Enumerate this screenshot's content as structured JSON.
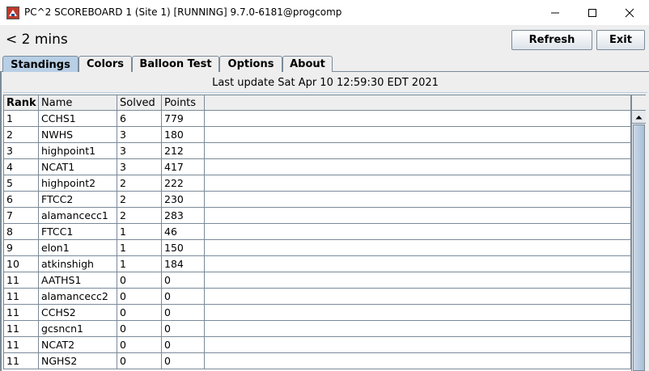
{
  "window": {
    "title": "PC^2 SCOREBOARD 1 (Site 1) [RUNNING] 9.7.0-6181@progcomp",
    "controls": [
      "minimize-icon",
      "maximize-icon",
      "close-icon"
    ]
  },
  "toolbar": {
    "elapsed": "< 2 mins",
    "refresh_label": "Refresh",
    "exit_label": "Exit"
  },
  "tabs": [
    {
      "label": "Standings",
      "selected": true
    },
    {
      "label": "Colors",
      "selected": false
    },
    {
      "label": "Balloon Test",
      "selected": false
    },
    {
      "label": "Options",
      "selected": false
    },
    {
      "label": "About",
      "selected": false
    }
  ],
  "standings": {
    "last_update": "Last update Sat Apr 10 12:59:30 EDT 2021",
    "columns": [
      "Rank",
      "Name",
      "Solved",
      "Points",
      ""
    ],
    "rows": [
      [
        "1",
        "CCHS1",
        "6",
        "779"
      ],
      [
        "2",
        "NWHS",
        "3",
        "180"
      ],
      [
        "3",
        "highpoint1",
        "3",
        "212"
      ],
      [
        "4",
        "NCAT1",
        "3",
        "417"
      ],
      [
        "5",
        "highpoint2",
        "2",
        "222"
      ],
      [
        "6",
        "FTCC2",
        "2",
        "230"
      ],
      [
        "7",
        "alamancecc1",
        "2",
        "283"
      ],
      [
        "8",
        "FTCC1",
        "1",
        "46"
      ],
      [
        "9",
        "elon1",
        "1",
        "150"
      ],
      [
        "10",
        "atkinshigh",
        "1",
        "184"
      ],
      [
        "11",
        "AATHS1",
        "0",
        "0"
      ],
      [
        "11",
        "alamancecc2",
        "0",
        "0"
      ],
      [
        "11",
        "CCHS2",
        "0",
        "0"
      ],
      [
        "11",
        "gcsncn1",
        "0",
        "0"
      ],
      [
        "11",
        "NCAT2",
        "0",
        "0"
      ],
      [
        "11",
        "NGHS2",
        "0",
        "0"
      ]
    ]
  }
}
